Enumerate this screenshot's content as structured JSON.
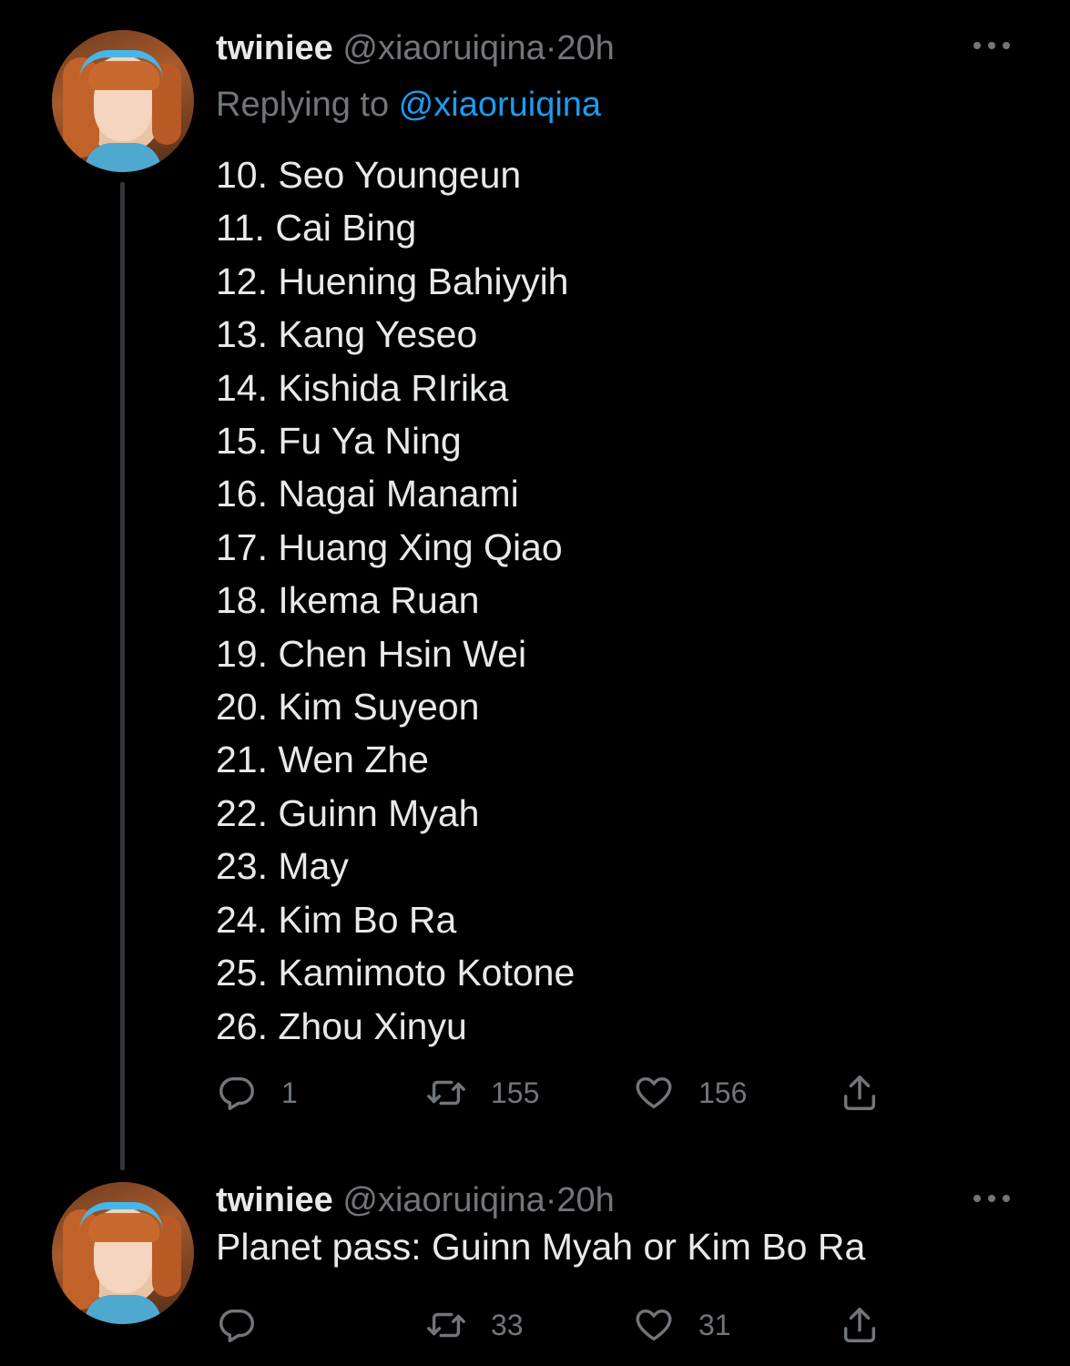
{
  "tweets": [
    {
      "name": "twiniee",
      "handle": "@xiaoruiqina",
      "separator": "·",
      "time": "20h",
      "replying_prefix": "Replying to ",
      "replying_to": "@xiaoruiqina",
      "lines": [
        "10. Seo Youngeun",
        "11. Cai Bing",
        "12. Huening Bahiyyih",
        "13. Kang Yeseo",
        "14. Kishida RIrika",
        "15. Fu Ya Ning",
        "16. Nagai Manami",
        "17. Huang Xing Qiao",
        "18. Ikema Ruan",
        "19. Chen Hsin Wei",
        "20. Kim Suyeon",
        "21. Wen Zhe",
        "22. Guinn Myah",
        "23. May",
        "24. Kim Bo Ra",
        "25. Kamimoto Kotone",
        "26. Zhou Xinyu"
      ],
      "replies": "1",
      "retweets": "155",
      "likes": "156"
    },
    {
      "name": "twiniee",
      "handle": "@xiaoruiqina",
      "separator": "·",
      "time": "20h",
      "text": "Planet pass: Guinn Myah or Kim Bo Ra",
      "replies": "",
      "retweets": "33",
      "likes": "31"
    }
  ],
  "icons": {
    "reply": "reply-icon",
    "retweet": "retweet-icon",
    "like": "heart-icon",
    "share": "share-icon",
    "more": "more-icon"
  },
  "colors": {
    "background": "#000000",
    "text": "#e7e9ea",
    "muted": "#71767b",
    "link": "#1d9bf0",
    "thread_line": "#333639"
  }
}
